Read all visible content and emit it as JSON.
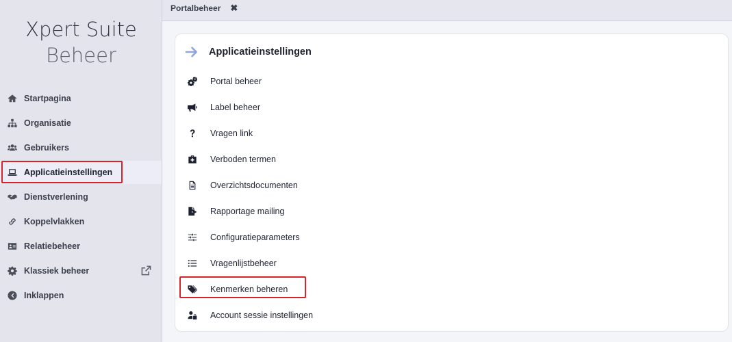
{
  "sidebar": {
    "brand_line1": "Xpert Suite",
    "brand_line2": "Beheer",
    "items": [
      {
        "label": "Startpagina",
        "icon": "home-icon"
      },
      {
        "label": "Organisatie",
        "icon": "sitemap-icon"
      },
      {
        "label": "Gebruikers",
        "icon": "users-icon"
      },
      {
        "label": "Applicatieinstellingen",
        "icon": "laptop-icon",
        "active": true
      },
      {
        "label": "Dienstverlening",
        "icon": "handshake-icon"
      },
      {
        "label": "Koppelvlakken",
        "icon": "link-icon"
      },
      {
        "label": "Relatiebeheer",
        "icon": "id-card-icon"
      },
      {
        "label": "Klassiek beheer",
        "icon": "cog-icon",
        "external": true
      },
      {
        "label": "Inklappen",
        "icon": "chevron-left-circle-icon"
      }
    ]
  },
  "tabs": [
    {
      "label": "Portalbeheer",
      "close": "✖"
    }
  ],
  "card": {
    "title": "Applicatieinstellingen",
    "items": [
      {
        "label": "Portal beheer",
        "icon": "cogs-icon"
      },
      {
        "label": "Label beheer",
        "icon": "megaphone-icon"
      },
      {
        "label": "Vragen link",
        "icon": "question-icon"
      },
      {
        "label": "Verboden termen",
        "icon": "first-aid-icon"
      },
      {
        "label": "Overzichtsdocumenten",
        "icon": "document-icon"
      },
      {
        "label": "Rapportage mailing",
        "icon": "file-export-icon"
      },
      {
        "label": "Configuratieparameters",
        "icon": "sliders-icon"
      },
      {
        "label": "Vragenlijstbeheer",
        "icon": "list-icon"
      },
      {
        "label": "Kenmerken beheren",
        "icon": "tags-icon"
      },
      {
        "label": "Account sessie instellingen",
        "icon": "user-lock-icon"
      }
    ]
  },
  "colors": {
    "highlight": "#d9232b",
    "arrow": "#8fa6e0",
    "sidebar_bg": "#e3e4ec"
  }
}
